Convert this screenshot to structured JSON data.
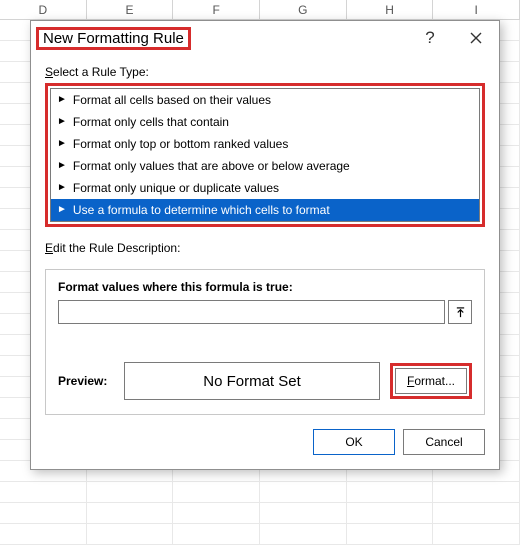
{
  "columns": [
    "D",
    "E",
    "F",
    "G",
    "H",
    "I"
  ],
  "dialog": {
    "title": "New Formatting Rule",
    "select_label_ul": "S",
    "select_label_rest": "elect a Rule Type:",
    "rule_types": [
      {
        "label": "Format all cells based on their values",
        "selected": false
      },
      {
        "label": "Format only cells that contain",
        "selected": false
      },
      {
        "label": "Format only top or bottom ranked values",
        "selected": false
      },
      {
        "label": "Format only values that are above or below average",
        "selected": false
      },
      {
        "label": "Format only unique or duplicate values",
        "selected": false
      },
      {
        "label": "Use a formula to determine which cells to format",
        "selected": true
      }
    ],
    "edit_label_ul": "E",
    "edit_label_rest": "dit the Rule Description:",
    "formula_heading": "Format values where this formula is true:",
    "formula_value": "",
    "preview_label": "Preview:",
    "preview_text": "No Format Set",
    "format_btn_ul": "F",
    "format_btn_rest": "ormat...",
    "ok_label": "OK",
    "cancel_label": "Cancel"
  }
}
